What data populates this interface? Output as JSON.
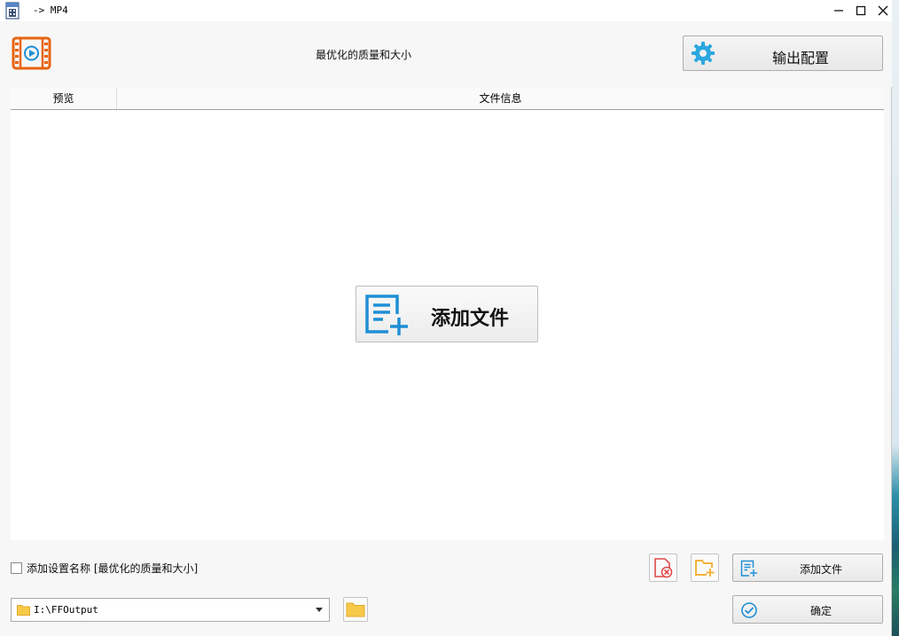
{
  "window": {
    "title": "-> MP4",
    "icons": {
      "app": "video-file-icon",
      "minimize": "minimize-icon",
      "maximize": "maximize-icon",
      "close": "close-icon"
    }
  },
  "header": {
    "preset_title": "最优化的质量和大小",
    "output_config_label": "输出配置",
    "icons": {
      "logo": "video-play-icon",
      "config": "gear-icon"
    }
  },
  "file_list": {
    "columns": [
      "预览",
      "文件信息"
    ],
    "add_file_label": "添加文件",
    "icons": {
      "add_file": "add-file-icon"
    }
  },
  "footer": {
    "add_setting_name_label": "添加设置名称 [最优化的质量和大小]",
    "add_setting_name_checked": false,
    "add_file_label": "添加文件",
    "ok_label": "确定",
    "output_path": "I:\\FFOutput",
    "icons": {
      "clear": "clear-list-icon",
      "add_folder": "add-folder-icon",
      "folder": "folder-icon",
      "ok": "check-circle-icon",
      "dropdown": "chevron-down-icon"
    }
  },
  "colors": {
    "accent_orange": "#e8640f",
    "accent_blue": "#1e8fd6",
    "gear_blue": "#2aa7e0",
    "clear_red": "#e04b4b",
    "folder_yellow": "#f2b33d"
  }
}
